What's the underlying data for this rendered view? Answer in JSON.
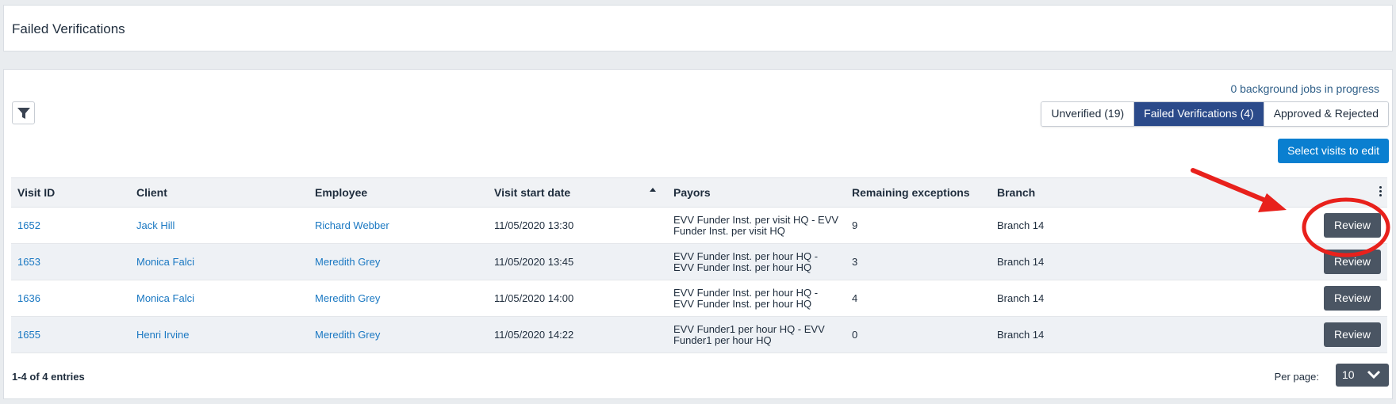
{
  "header": {
    "title": "Failed Verifications"
  },
  "toolbar": {
    "background_jobs": "0 background jobs in progress",
    "filter_icon": "filter-icon",
    "tabs": [
      {
        "label": "Unverified (19)",
        "active": false
      },
      {
        "label": "Failed Verifications (4)",
        "active": true
      },
      {
        "label": "Approved & Rejected",
        "active": false
      }
    ],
    "select_label": "Select visits to edit"
  },
  "table": {
    "columns": [
      "Visit ID",
      "Client",
      "Employee",
      "Visit start date",
      "Payors",
      "Remaining exceptions",
      "Branch"
    ],
    "sorted_column": "Visit start date",
    "sort_direction": "ascending",
    "rows": [
      {
        "visit_id": "1652",
        "client": "Jack Hill",
        "employee": "Richard Webber",
        "start": "11/05/2020 13:30",
        "payors": "EVV Funder Inst. per visit HQ - EVV Funder Inst. per visit HQ",
        "exceptions": "9",
        "branch": "Branch 14",
        "action": "Review"
      },
      {
        "visit_id": "1653",
        "client": "Monica Falci",
        "employee": "Meredith Grey",
        "start": "11/05/2020 13:45",
        "payors": "EVV Funder Inst. per hour HQ - EVV Funder Inst. per hour HQ",
        "exceptions": "3",
        "branch": "Branch 14",
        "action": "Review"
      },
      {
        "visit_id": "1636",
        "client": "Monica Falci",
        "employee": "Meredith Grey",
        "start": "11/05/2020 14:00",
        "payors": "EVV Funder Inst. per hour HQ - EVV Funder Inst. per hour HQ",
        "exceptions": "4",
        "branch": "Branch 14",
        "action": "Review"
      },
      {
        "visit_id": "1655",
        "client": "Henri Irvine",
        "employee": "Meredith Grey",
        "start": "11/05/2020 14:22",
        "payors": "EVV Funder1 per hour HQ - EVV Funder1 per hour HQ",
        "exceptions": "0",
        "branch": "Branch 14",
        "action": "Review"
      }
    ]
  },
  "footer": {
    "entries": "1-4 of 4 entries",
    "per_page_label": "Per page:",
    "per_page_value": "10"
  },
  "colors": {
    "active_tab": "#2b4a8a",
    "primary_button": "#0a7fd0",
    "review_button": "#4a5563",
    "link": "#1a78c2",
    "annotation": "#e8211c"
  }
}
